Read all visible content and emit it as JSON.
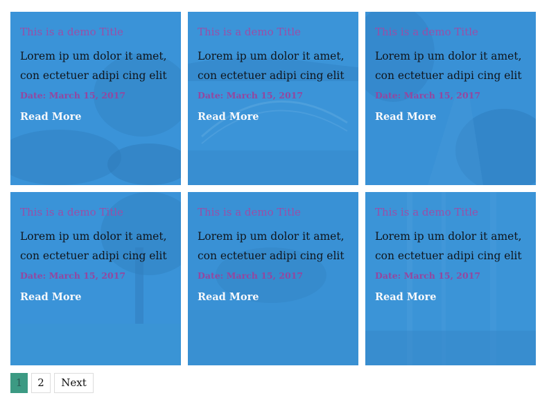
{
  "colors": {
    "card_background": "#3a92d6",
    "title_color": "#9a4ea7",
    "date_color": "#94479f",
    "readmore_color": "#f6f8fb",
    "pagination_active": "#3c9a83"
  },
  "cards": [
    {
      "title": "This is a demo Title",
      "excerpt": "Lorem ip um dolor it amet, con ectetuer adipi cing elit",
      "date": "Date: March 15, 2017",
      "read_more": "Read More",
      "background": "garden"
    },
    {
      "title": "This is a demo Title",
      "excerpt": "Lorem ip um dolor it amet, con ectetuer adipi cing elit",
      "date": "Date: March 15, 2017",
      "read_more": "Read More",
      "background": "bridge"
    },
    {
      "title": "This is a demo Title",
      "excerpt": "Lorem ip um dolor it amet, con ectetuer adipi cing elit",
      "date": "Date: March 15, 2017",
      "read_more": "Read More",
      "background": "forest-path"
    },
    {
      "title": "This is a demo Title",
      "excerpt": "Lorem ip um dolor it amet, con ectetuer adipi cing elit",
      "date": "Date: March 15, 2017",
      "read_more": "Read More",
      "background": "tree-field"
    },
    {
      "title": "This is a demo Title",
      "excerpt": "Lorem ip um dolor it amet, con ectetuer adipi cing elit",
      "date": "Date: March 15, 2017",
      "read_more": "Read More",
      "background": "lone-tree"
    },
    {
      "title": "This is a demo Title",
      "excerpt": "Lorem ip um dolor it amet, con ectetuer adipi cing elit",
      "date": "Date: March 15, 2017",
      "read_more": "Read More",
      "background": "birch-forest"
    }
  ],
  "pagination": {
    "pages": [
      "1",
      "2"
    ],
    "current": "1",
    "next_label": "Next"
  }
}
